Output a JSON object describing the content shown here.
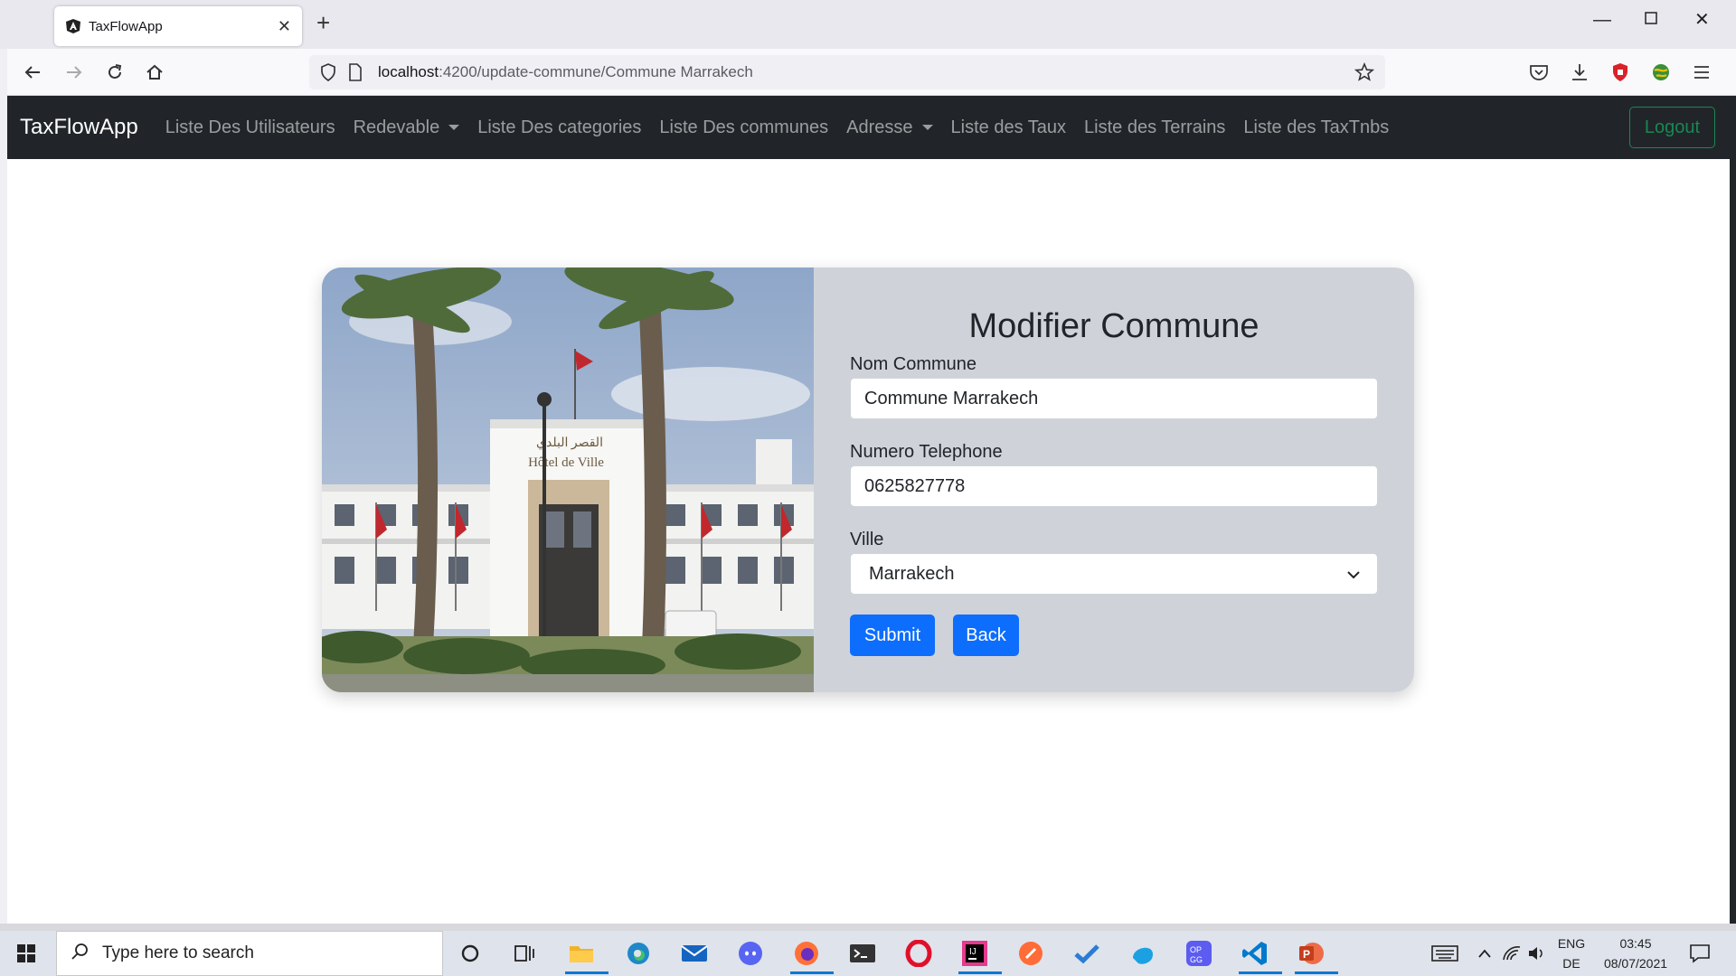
{
  "browser": {
    "tab_title": "TaxFlowApp",
    "url_host": "localhost",
    "url_path": ":4200/update-commune/Commune Marrakech"
  },
  "app": {
    "brand": "TaxFlowApp",
    "nav": {
      "users": "Liste Des Utilisateurs",
      "redevable": "Redevable",
      "categories": "Liste Des categories",
      "communes": "Liste Des communes",
      "adresse": "Adresse",
      "taux": "Liste des Taux",
      "terrains": "Liste des Terrains",
      "taxtnbs": "Liste des TaxTnbs"
    },
    "logout_label": "Logout"
  },
  "form": {
    "title": "Modifier Commune",
    "nom_label": "Nom Commune",
    "nom_value": "Commune Marrakech",
    "tel_label": "Numero Telephone",
    "tel_value": "0625827778",
    "ville_label": "Ville",
    "ville_value": "Marrakech",
    "submit_label": "Submit",
    "back_label": "Back"
  },
  "taskbar": {
    "search_placeholder": "Type here to search",
    "lang_top": "ENG",
    "lang_bottom": "DE",
    "time": "03:45",
    "date": "08/07/2021"
  },
  "colors": {
    "navbar_bg": "#212529",
    "primary": "#0d6efd",
    "success": "#198754",
    "form_panel_bg": "#cfd3d9"
  }
}
